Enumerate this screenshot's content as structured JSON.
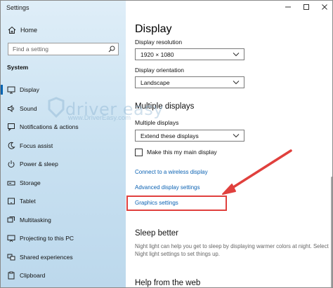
{
  "window": {
    "title": "Settings",
    "controls": {
      "minimize": "minimize-icon",
      "maximize": "maximize-icon",
      "close": "close-icon"
    }
  },
  "sidebar": {
    "home_label": "Home",
    "search_placeholder": "Find a setting",
    "section_label": "System",
    "items": [
      {
        "label": "Display",
        "icon": "monitor-icon",
        "active": true
      },
      {
        "label": "Sound",
        "icon": "speaker-icon",
        "active": false
      },
      {
        "label": "Notifications & actions",
        "icon": "notification-icon",
        "active": false
      },
      {
        "label": "Focus assist",
        "icon": "moon-icon",
        "active": false
      },
      {
        "label": "Power & sleep",
        "icon": "power-icon",
        "active": false
      },
      {
        "label": "Storage",
        "icon": "storage-icon",
        "active": false
      },
      {
        "label": "Tablet",
        "icon": "tablet-icon",
        "active": false
      },
      {
        "label": "Multitasking",
        "icon": "multitasking-icon",
        "active": false
      },
      {
        "label": "Projecting to this PC",
        "icon": "projector-icon",
        "active": false
      },
      {
        "label": "Shared experiences",
        "icon": "shared-icon",
        "active": false
      },
      {
        "label": "Clipboard",
        "icon": "clipboard-icon",
        "active": false
      }
    ]
  },
  "main": {
    "title": "Display",
    "resolution": {
      "label": "Display resolution",
      "value": "1920 × 1080"
    },
    "orientation": {
      "label": "Display orientation",
      "value": "Landscape"
    },
    "multiple_displays": {
      "heading": "Multiple displays",
      "label": "Multiple displays",
      "value": "Extend these displays",
      "checkbox_label": "Make this my main display"
    },
    "links": {
      "wireless": "Connect to a wireless display",
      "advanced": "Advanced display settings",
      "graphics": "Graphics settings"
    },
    "sleep_better": {
      "heading": "Sleep better",
      "text": "Night light can help you get to sleep by displaying warmer colors at night. Select Night light settings to set things up."
    },
    "help_heading": "Help from the web"
  },
  "watermark": {
    "text": "driver easy",
    "url": "www.DriverEasy.com"
  },
  "colors": {
    "accent": "#0063b1",
    "link": "#0b62b3",
    "annotation": "#e0403d"
  }
}
